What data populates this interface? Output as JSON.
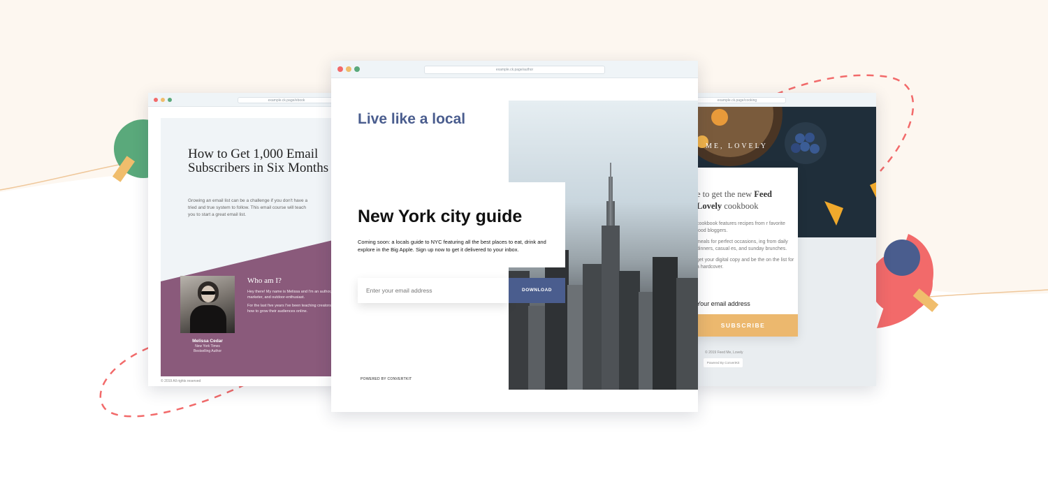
{
  "colors": {
    "accent_blue": "#4a5d8e",
    "purple": "#8a5a7b",
    "orange": "#ecb86e",
    "coral": "#f26a6a",
    "green": "#5aa97b"
  },
  "left_page": {
    "url": "example.ck.page/ebook",
    "title": "How to Get 1,000 Email Subscribers in Six Months",
    "description": "Growing an email list can be a challenge if you don't have a tried and true system to follow. This email course will teach you to start a great email list.",
    "about_heading": "Who am I?",
    "bio_1": "Hey there! My name is Melissa and I'm an author, marketer, and outdoor-enthusiast.",
    "bio_2": "For the last five years I've been teaching creators how to grow their audiences online.",
    "author_name": "Melissa Cedar",
    "author_role_1": "New York Times",
    "author_role_2": "Bestselling Author",
    "footer": "© 2019 All rights reserved"
  },
  "center_page": {
    "url": "example.ck.page/author",
    "subtitle": "Live like a local",
    "title": "New York city guide",
    "description": "Coming soon: a locals guide to NYC featuring all the best places to eat, drink and explore in the Big Apple. Sign up now to get it delivered to your inbox.",
    "email_placeholder": "Enter your email address",
    "button_label": "DOWNLOAD",
    "powered_by": "POWERED BY CONVERTKIT"
  },
  "right_page": {
    "url": "example.ck.page/cooking",
    "brand": "ME, LOVELY",
    "heading_1": "e to get the new ",
    "heading_bold_1": "Feed",
    "heading_bold_2": "Lovely",
    "heading_2": " cookbook",
    "para_1": "cookbook features recipes from r favorite food bloggers.",
    "para_2": "meals for perfect occasions, ing from daily dinners, casual es, and sunday brunches.",
    "para_3": "get your digital copy and be the on the list for a hardcover.",
    "email_label": "Your email address",
    "button_label": "SUBSCRIBE",
    "copyright": "© 2019 Feed Me, Lovely",
    "powered_by": "Powered By ConvertKit"
  }
}
